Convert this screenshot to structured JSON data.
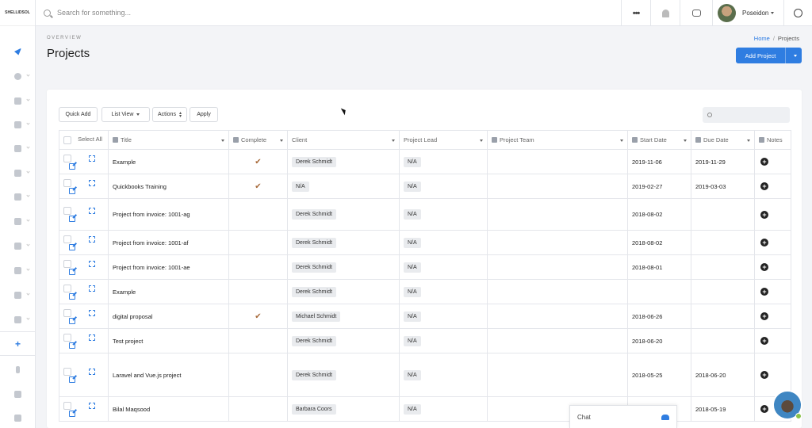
{
  "sidebar": {
    "logo_text": "SHELLIDSOL"
  },
  "topbar": {
    "search_placeholder": "Search for something...",
    "more_icon": "more-horizontal-icon",
    "username": "Poseidon"
  },
  "header": {
    "overview": "OVERVIEW",
    "title": "Projects",
    "breadcrumb_home": "Home",
    "breadcrumb_sep": "/",
    "breadcrumb_current": "Projects",
    "add_button": "Add Project"
  },
  "toolbar": {
    "quick_add": "Quick Add",
    "list_view": "List View",
    "actions": "Actions",
    "apply": "Apply"
  },
  "table": {
    "columns": {
      "select_all": "Select All",
      "title": "Title",
      "complete": "Complete",
      "client": "Client",
      "project_lead": "Project Lead",
      "project_team": "Project Team",
      "start_date": "Start Date",
      "due_date": "Due Date",
      "notes": "Notes"
    },
    "rows": [
      {
        "title": "Example",
        "complete": "✔",
        "client": "Derek Schmidt",
        "lead": "N/A",
        "start": "2019-11-06",
        "due": "2019-11-29"
      },
      {
        "title": "Quickbooks Training",
        "complete": "✔",
        "client": "N/A",
        "lead": "N/A",
        "start": "2019-02-27",
        "due": "2019-03-03"
      },
      {
        "title": "Project from invoice: 1001-ag",
        "complete": "",
        "client": "Derek Schmidt",
        "lead": "N/A",
        "start": "2018-08-02",
        "due": ""
      },
      {
        "title": "Project from invoice: 1001-af",
        "complete": "",
        "client": "Derek Schmidt",
        "lead": "N/A",
        "start": "2018-08-02",
        "due": ""
      },
      {
        "title": "Project from invoice: 1001-ae",
        "complete": "",
        "client": "Derek Schmidt",
        "lead": "N/A",
        "start": "2018-08-01",
        "due": ""
      },
      {
        "title": "Example",
        "complete": "",
        "client": "Derek Schmidt",
        "lead": "N/A",
        "start": "",
        "due": ""
      },
      {
        "title": "digital proposal",
        "complete": "✔",
        "client": "Michael Schmidt",
        "lead": "N/A",
        "start": "2018-06-26",
        "due": ""
      },
      {
        "title": "Test project",
        "complete": "",
        "client": "Derek Schmidt",
        "lead": "N/A",
        "start": "2018-06-20",
        "due": ""
      },
      {
        "title": "Laravel and Vue.js project",
        "complete": "",
        "client": "Derek Schmidt",
        "lead": "N/A",
        "start": "2018-05-25",
        "due": "2018-06-20"
      },
      {
        "title": "Bilal Maqsood",
        "complete": "",
        "client": "Barbara Coors",
        "lead": "N/A",
        "start": "",
        "due": "2018-05-19"
      }
    ]
  },
  "chat": {
    "label": "Chat"
  }
}
